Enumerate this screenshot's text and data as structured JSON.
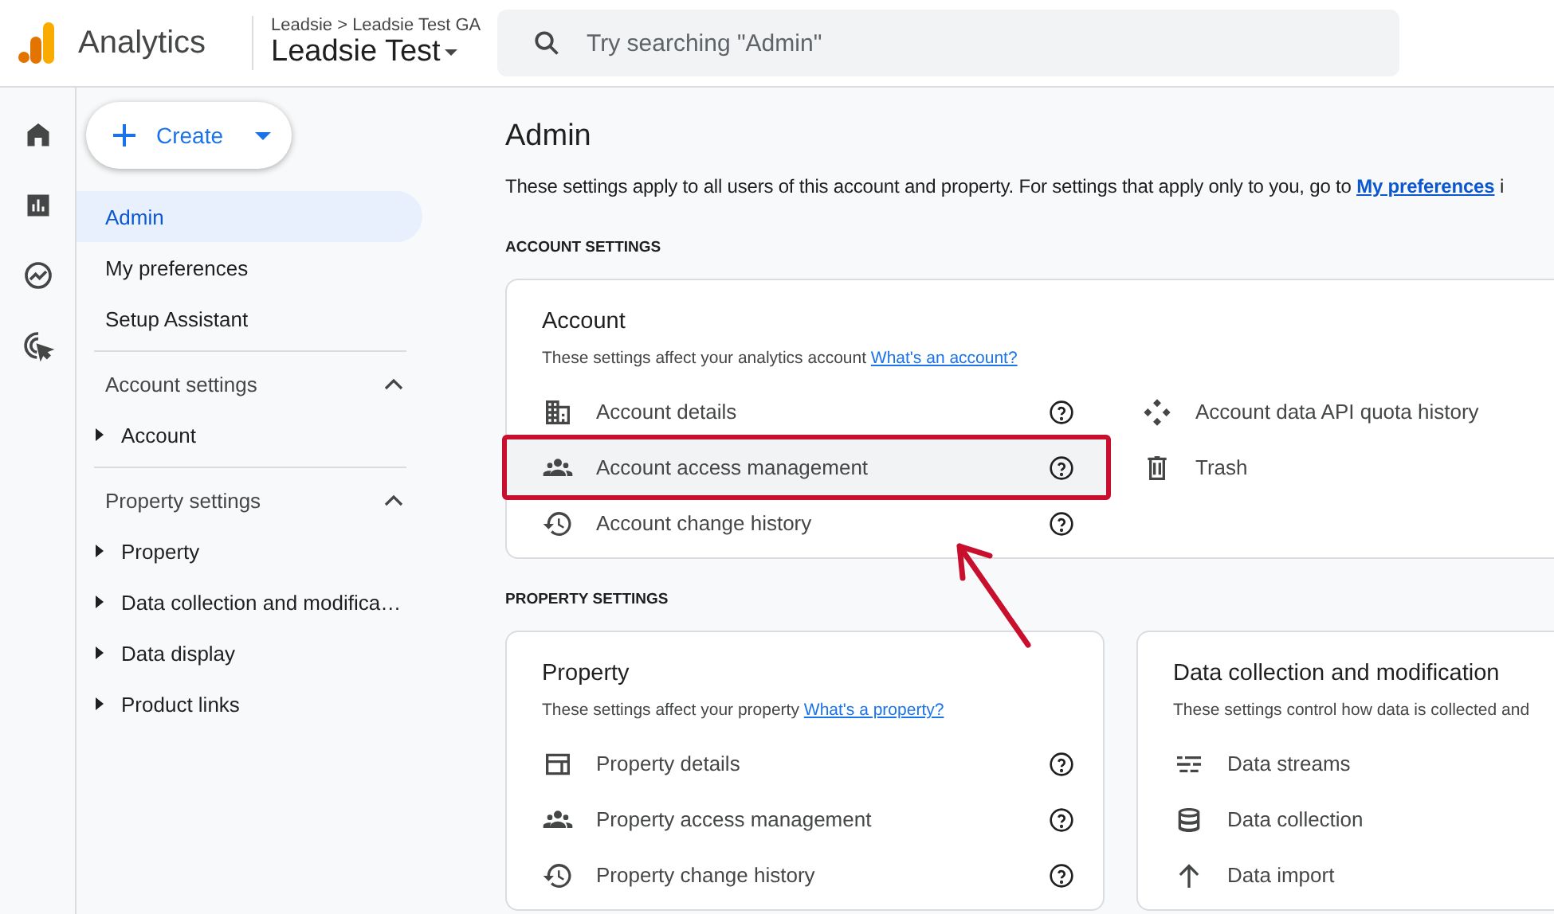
{
  "header": {
    "product": "Analytics",
    "breadcrumb": "Leadsie > Leadsie Test GA",
    "property": "Leadsie Test",
    "search": {
      "placeholder": "Try searching \"Admin\""
    }
  },
  "create_button": "Create",
  "sidebar": {
    "items": [
      {
        "label": "Admin",
        "selected": true
      },
      {
        "label": "My preferences",
        "selected": false
      },
      {
        "label": "Setup Assistant",
        "selected": false
      }
    ],
    "sections": [
      {
        "title": "Account settings",
        "expanded": true,
        "items": [
          "Account"
        ]
      },
      {
        "title": "Property settings",
        "expanded": true,
        "items": [
          "Property",
          "Data collection and modifica…",
          "Data display",
          "Product links"
        ]
      }
    ]
  },
  "page": {
    "title": "Admin",
    "description": "These settings apply to all users of this account and property. For settings that apply only to you, go to",
    "description_link": "My preferences",
    "description_tail": "i"
  },
  "groups": [
    {
      "heading": "ACCOUNT SETTINGS",
      "cards": [
        {
          "title": "Account",
          "description": "These settings affect your analytics account",
          "link": "What's an account?",
          "wide": true,
          "columns": [
            [
              {
                "label": "Account details",
                "help": true,
                "highlighted": false
              },
              {
                "label": "Account access management",
                "help": true,
                "highlighted": true
              },
              {
                "label": "Account change history",
                "help": true,
                "highlighted": false
              }
            ],
            [
              {
                "label": "Account data API quota history",
                "highlighted": false
              },
              {
                "label": "Trash",
                "highlighted": false
              }
            ]
          ]
        }
      ]
    },
    {
      "heading": "PROPERTY SETTINGS",
      "cards": [
        {
          "title": "Property",
          "description": "These settings affect your property",
          "link": "What's a property?",
          "wide": false,
          "columns": [
            [
              {
                "label": "Property details",
                "help": true,
                "highlighted": false
              },
              {
                "label": "Property access management",
                "help": true,
                "highlighted": false
              },
              {
                "label": "Property change history",
                "help": true,
                "highlighted": false
              }
            ]
          ]
        },
        {
          "title": "Data collection and modification",
          "description": "These settings control how data is collected and",
          "wide": false,
          "columns": [
            [
              {
                "label": "Data streams",
                "highlighted": false
              },
              {
                "label": "Data collection",
                "highlighted": false
              },
              {
                "label": "Data import",
                "highlighted": false
              }
            ]
          ]
        }
      ]
    }
  ]
}
